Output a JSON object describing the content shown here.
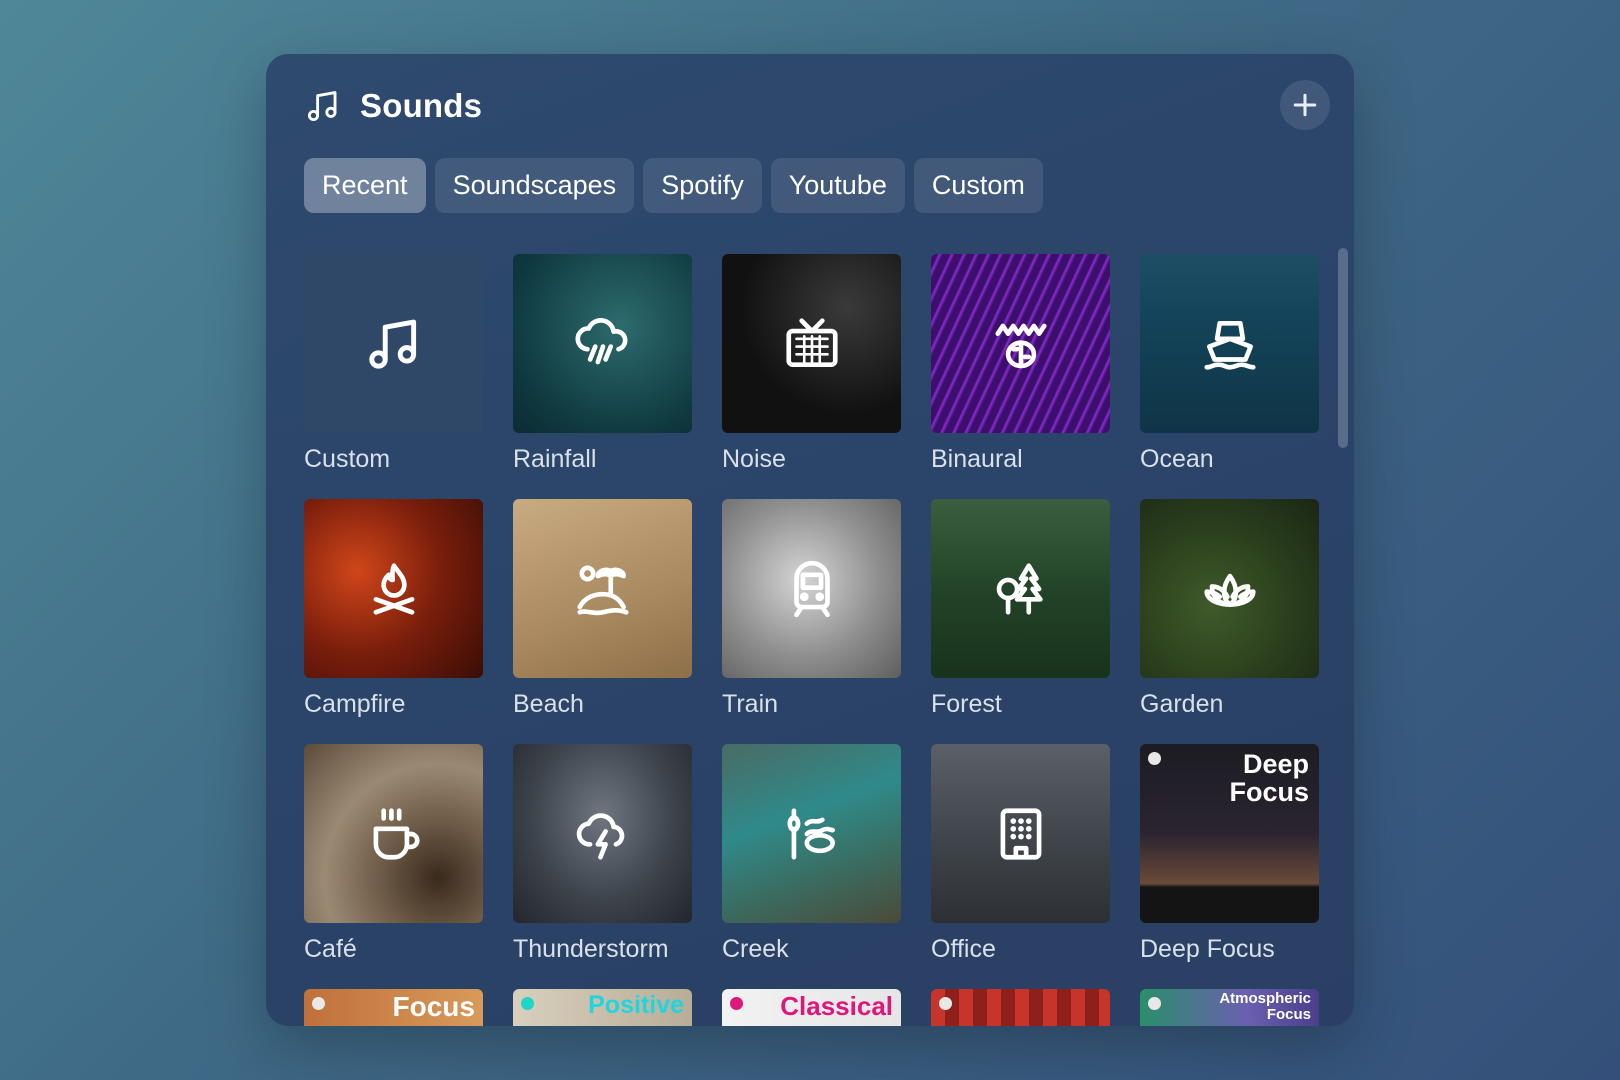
{
  "header": {
    "title": "Sounds",
    "icon": "music-note-icon",
    "add_icon": "plus-icon"
  },
  "tabs": [
    {
      "label": "Recent",
      "active": true
    },
    {
      "label": "Soundscapes",
      "active": false
    },
    {
      "label": "Spotify",
      "active": false
    },
    {
      "label": "Youtube",
      "active": false
    },
    {
      "label": "Custom",
      "active": false
    }
  ],
  "tiles": [
    {
      "label": "Custom",
      "icon": "music-note-icon"
    },
    {
      "label": "Rainfall",
      "icon": "rain-cloud-icon"
    },
    {
      "label": "Noise",
      "icon": "tv-static-icon"
    },
    {
      "label": "Binaural",
      "icon": "brain-wave-icon"
    },
    {
      "label": "Ocean",
      "icon": "ship-icon"
    },
    {
      "label": "Campfire",
      "icon": "campfire-icon"
    },
    {
      "label": "Beach",
      "icon": "island-icon"
    },
    {
      "label": "Train",
      "icon": "train-icon"
    },
    {
      "label": "Forest",
      "icon": "trees-icon"
    },
    {
      "label": "Garden",
      "icon": "lotus-icon"
    },
    {
      "label": "Café",
      "icon": "coffee-cup-icon"
    },
    {
      "label": "Thunderstorm",
      "icon": "storm-cloud-icon"
    },
    {
      "label": "Creek",
      "icon": "creek-icon"
    },
    {
      "label": "Office",
      "icon": "building-icon"
    },
    {
      "label": "Deep Focus",
      "cover_line1": "Deep",
      "cover_line2": "Focus",
      "icon": "spotify-icon"
    }
  ],
  "partial_row": [
    {
      "cover_text": "Focus"
    },
    {
      "cover_text": "Positive"
    },
    {
      "cover_text": "Classical"
    },
    {
      "cover_text": ""
    },
    {
      "cover_text": "Atmospheric Focus",
      "cover_line1": "Atmospheric",
      "cover_line2": "Focus"
    }
  ]
}
